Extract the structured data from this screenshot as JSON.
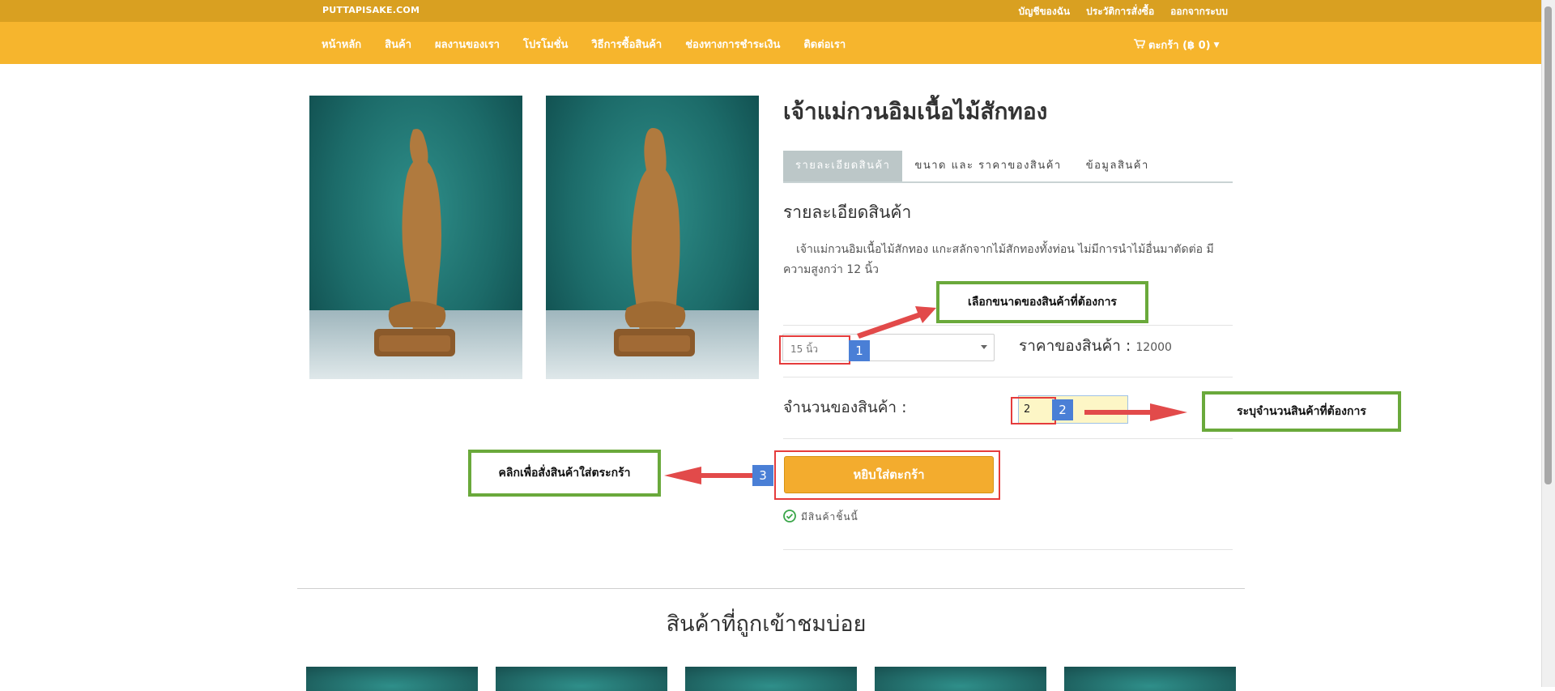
{
  "top": {
    "brand": "PUTTAPISAKE.COM",
    "links": [
      "บัญชีของฉัน",
      "ประวัติการสั่งซื้อ",
      "ออกจากระบบ"
    ]
  },
  "nav": {
    "items": [
      "หน้าหลัก",
      "สินค้า",
      "ผลงานของเรา",
      "โปรโมชั่น",
      "วิธีการซื้อสินค้า",
      "ช่องทางการชำระเงิน",
      "ติดต่อเรา"
    ],
    "cart": "ตะกร้า (฿ 0)"
  },
  "product": {
    "title": "เจ้าแม่กวนอิมเนื้อไม้สักทอง",
    "tabs": [
      "รายละเอียดสินค้า",
      "ขนาด และ ราคาของสินค้า",
      "ข้อมูลสินค้า"
    ],
    "active_tab": "รายละเอียดสินค้า",
    "subheading": "รายละเอียดสินค้า",
    "description": "เจ้าแม่กวนอิมเนื้อไม้สักทอง แกะสลักจากไม้สักทองทั้งท่อน ไม่มีการนำไม้อื่นมาตัดต่อ มีความสูงกว่า 12 นิ้ว",
    "size_value": "15 นิ้ว",
    "price_label": "ราคาของสินค้า :",
    "price_value": "12000",
    "qty_label": "จำนวนของสินค้า :",
    "qty_value": "2",
    "add_button": "หยิบใส่ตะกร้า",
    "stock_text": "มีสินค้าชิ้นนี้"
  },
  "section": {
    "popular_title": "สินค้าที่ถูกเข้าชมบ่อย"
  },
  "annotations": {
    "callout_1": "เลือกขนาดของสินค้าที่ต้องการ",
    "callout_2": "ระบุจำนวนสินค้าที่ต้องการ",
    "callout_3": "คลิกเพื่อสั่งสินค้าใส่ตระกร้า",
    "badge_1": "1",
    "badge_2": "2",
    "badge_3": "3"
  },
  "colors": {
    "topbar": "#d9a021",
    "navbar": "#f6b52d",
    "button": "#f3ac2e",
    "annotation_red": "#e53c3c",
    "annotation_green": "#6aa93b",
    "badge_blue": "#4a7fd6"
  }
}
